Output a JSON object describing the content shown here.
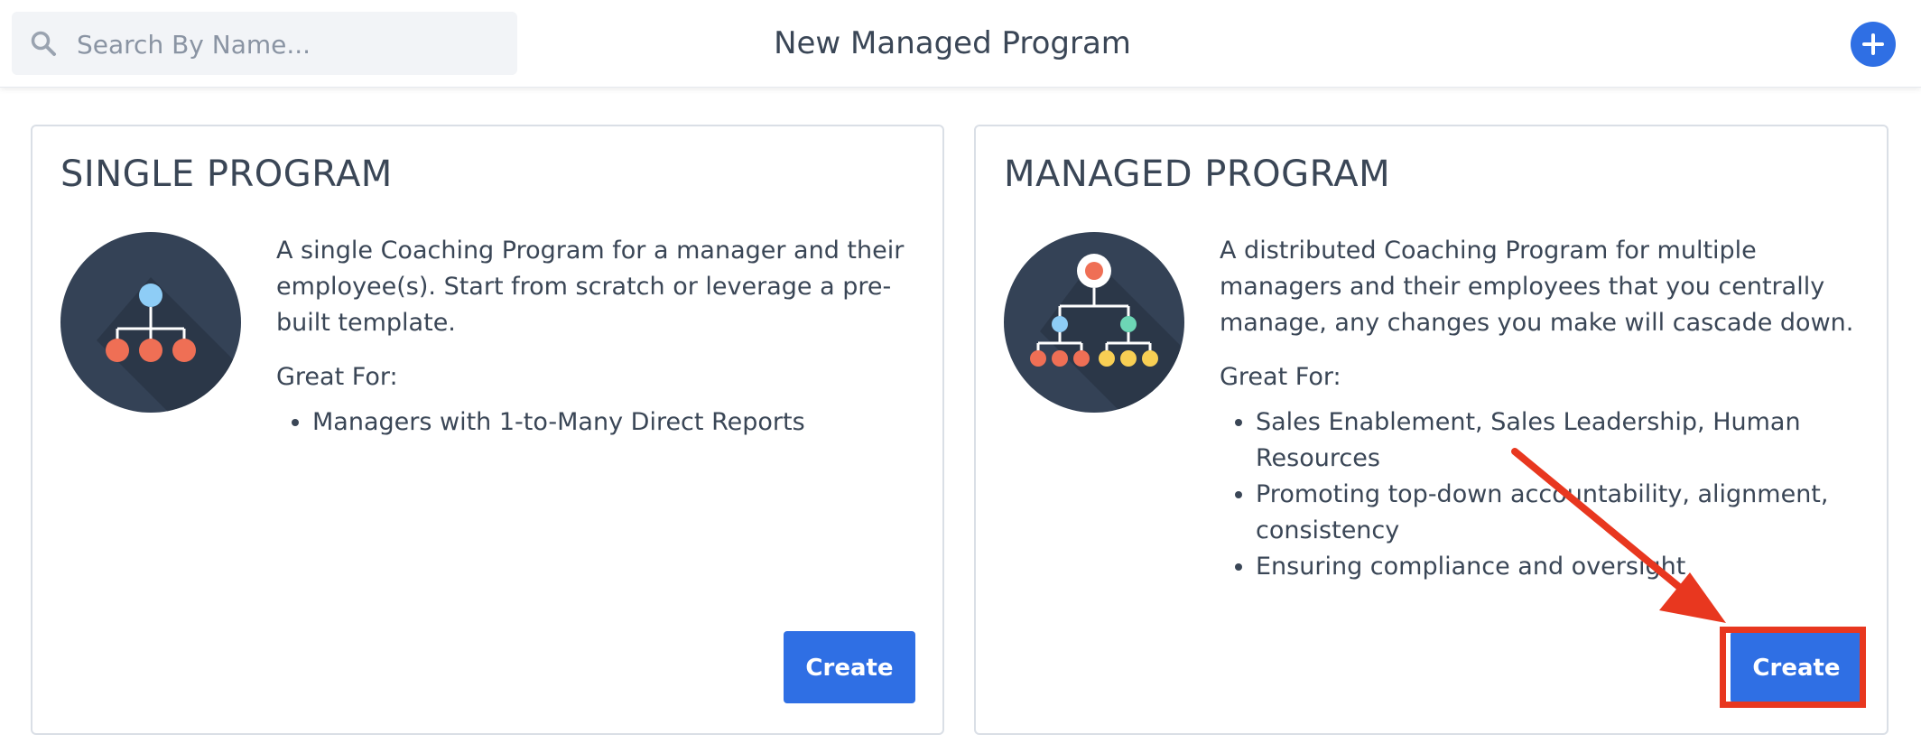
{
  "header": {
    "search_placeholder": "Search By Name...",
    "title": "New Managed Program",
    "add_icon": "plus-icon"
  },
  "cards": [
    {
      "title": "SINGLE PROGRAM",
      "description": "A single Coaching Program for a manager and their employee(s). Start from scratch or leverage a pre-built template.",
      "great_for_label": "Great For:",
      "bullets": [
        "Managers with 1-to-Many Direct Reports"
      ],
      "button_label": "Create",
      "icon": "org-chart-icon"
    },
    {
      "title": "MANAGED PROGRAM",
      "description": "A distributed Coaching Program for multiple managers and their employees that you centrally manage, any changes you make will cascade down.",
      "great_for_label": "Great For:",
      "bullets": [
        "Sales Enablement, Sales Leadership, Human Resources",
        "Promoting top-down accountability, alignment, consistency",
        "Ensuring compliance and oversight"
      ],
      "button_label": "Create",
      "icon": "multi-level-org-chart-icon"
    }
  ],
  "colors": {
    "accent": "#2f6fe4",
    "annotation": "#e8371f",
    "illustration_bg": "#344256"
  }
}
